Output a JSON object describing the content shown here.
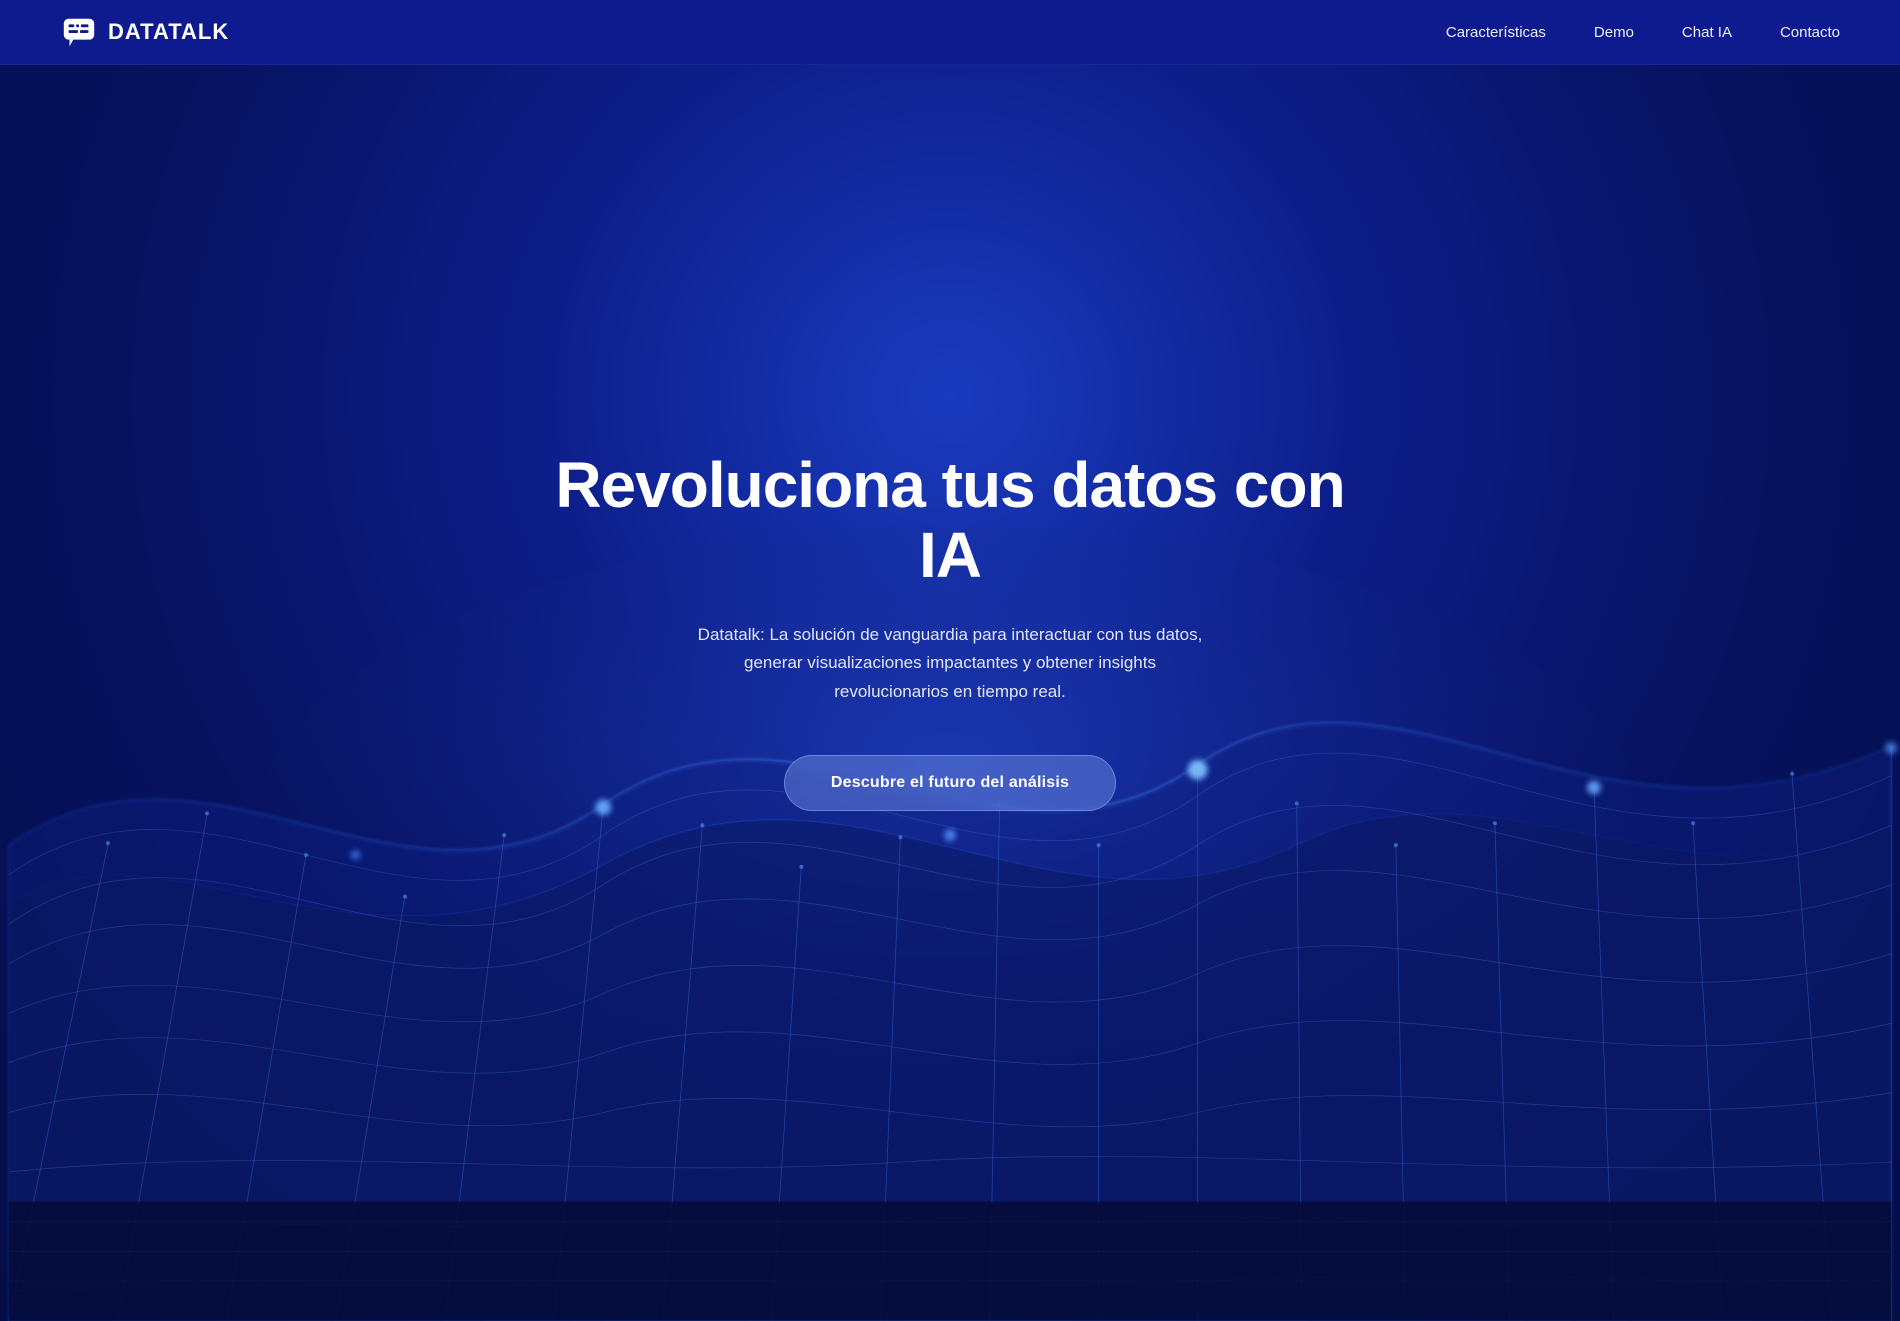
{
  "nav": {
    "logo_text": "DATATALK",
    "links": [
      {
        "label": "Características",
        "id": "caracteristicas"
      },
      {
        "label": "Demo",
        "id": "demo"
      },
      {
        "label": "Chat IA",
        "id": "chat-ia"
      },
      {
        "label": "Contacto",
        "id": "contacto"
      }
    ]
  },
  "hero": {
    "title": "Revoluciona tus datos con IA",
    "subtitle": "Datatalk: La solución de vanguardia para interactuar con tus datos, generar visualizaciones impactantes y obtener insights revolucionarios en tiempo real.",
    "cta_label": "Descubre el futuro del análisis"
  },
  "colors": {
    "nav_bg": "#0d1b8e",
    "hero_bg_start": "#1a3bbf",
    "hero_bg_end": "#050d45",
    "text_primary": "#ffffff",
    "cta_bg": "rgba(100,130,220,0.55)"
  }
}
